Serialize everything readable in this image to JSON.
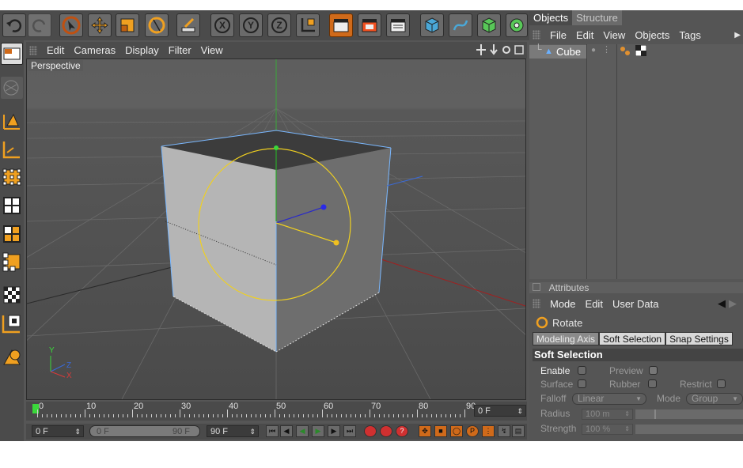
{
  "toolbar": {
    "undo_icon": "undo-icon",
    "redo_icon": "redo-icon",
    "axis_x_label": "X",
    "axis_y_label": "Y",
    "axis_z_label": "Z"
  },
  "viewport": {
    "menu": [
      "Edit",
      "Cameras",
      "Display",
      "Filter",
      "View"
    ],
    "camera_label": "Perspective",
    "axis_labels": {
      "x": "X",
      "y": "Y",
      "z": "Z"
    }
  },
  "timeline": {
    "ticks": [
      "0",
      "10",
      "20",
      "30",
      "40",
      "50",
      "60",
      "70",
      "80",
      "90"
    ],
    "current_frame": "0 F"
  },
  "controls": {
    "start_frame": "0 F",
    "range_start": "0 F",
    "range_end": "90 F",
    "end_frame": "90 F"
  },
  "objects_panel": {
    "tabs": [
      "Objects",
      "Structure"
    ],
    "menu": [
      "File",
      "Edit",
      "View",
      "Objects",
      "Tags"
    ],
    "items": [
      {
        "name": "Cube"
      }
    ]
  },
  "attributes_panel": {
    "title": "Attributes",
    "menu": [
      "Mode",
      "Edit",
      "User Data"
    ],
    "tool_name": "Rotate",
    "subtabs": [
      "Modeling Axis",
      "Soft Selection",
      "Snap Settings"
    ],
    "section": "Soft Selection",
    "enable_label": "Enable",
    "preview_label": "Preview",
    "surface_label": "Surface",
    "rubber_label": "Rubber",
    "restrict_label": "Restrict",
    "falloff_label": "Falloff",
    "falloff_value": "Linear",
    "mode_label": "Mode",
    "mode_value": "Group",
    "radius_label": "Radius",
    "radius_value": "100 m",
    "strength_label": "Strength",
    "strength_value": "100 %"
  },
  "colors": {
    "accent_orange": "#d06a1a",
    "selection_blue": "#6ab0ff",
    "gizmo_yellow": "#f0d020"
  }
}
